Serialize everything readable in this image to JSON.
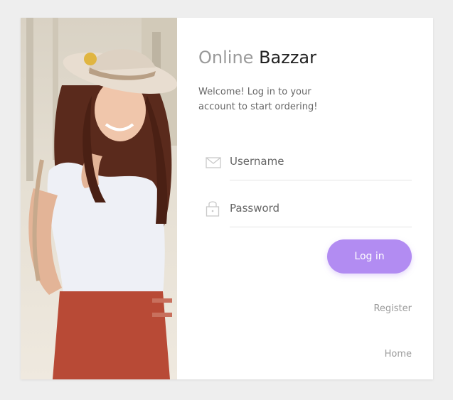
{
  "brand": {
    "title_light": "Online",
    "title_dark": "Bazzar"
  },
  "welcome_text": "Welcome! Log in to your account to start ordering!",
  "form": {
    "username": {
      "placeholder": "Username",
      "value": "",
      "icon": "envelope-icon"
    },
    "password": {
      "placeholder": "Password",
      "value": "",
      "icon": "lock-icon"
    },
    "login_label": "Log in"
  },
  "links": {
    "register": "Register",
    "home": "Home"
  },
  "colors": {
    "accent": "#b28cf2",
    "background": "#eeeeee",
    "card": "#ffffff"
  }
}
